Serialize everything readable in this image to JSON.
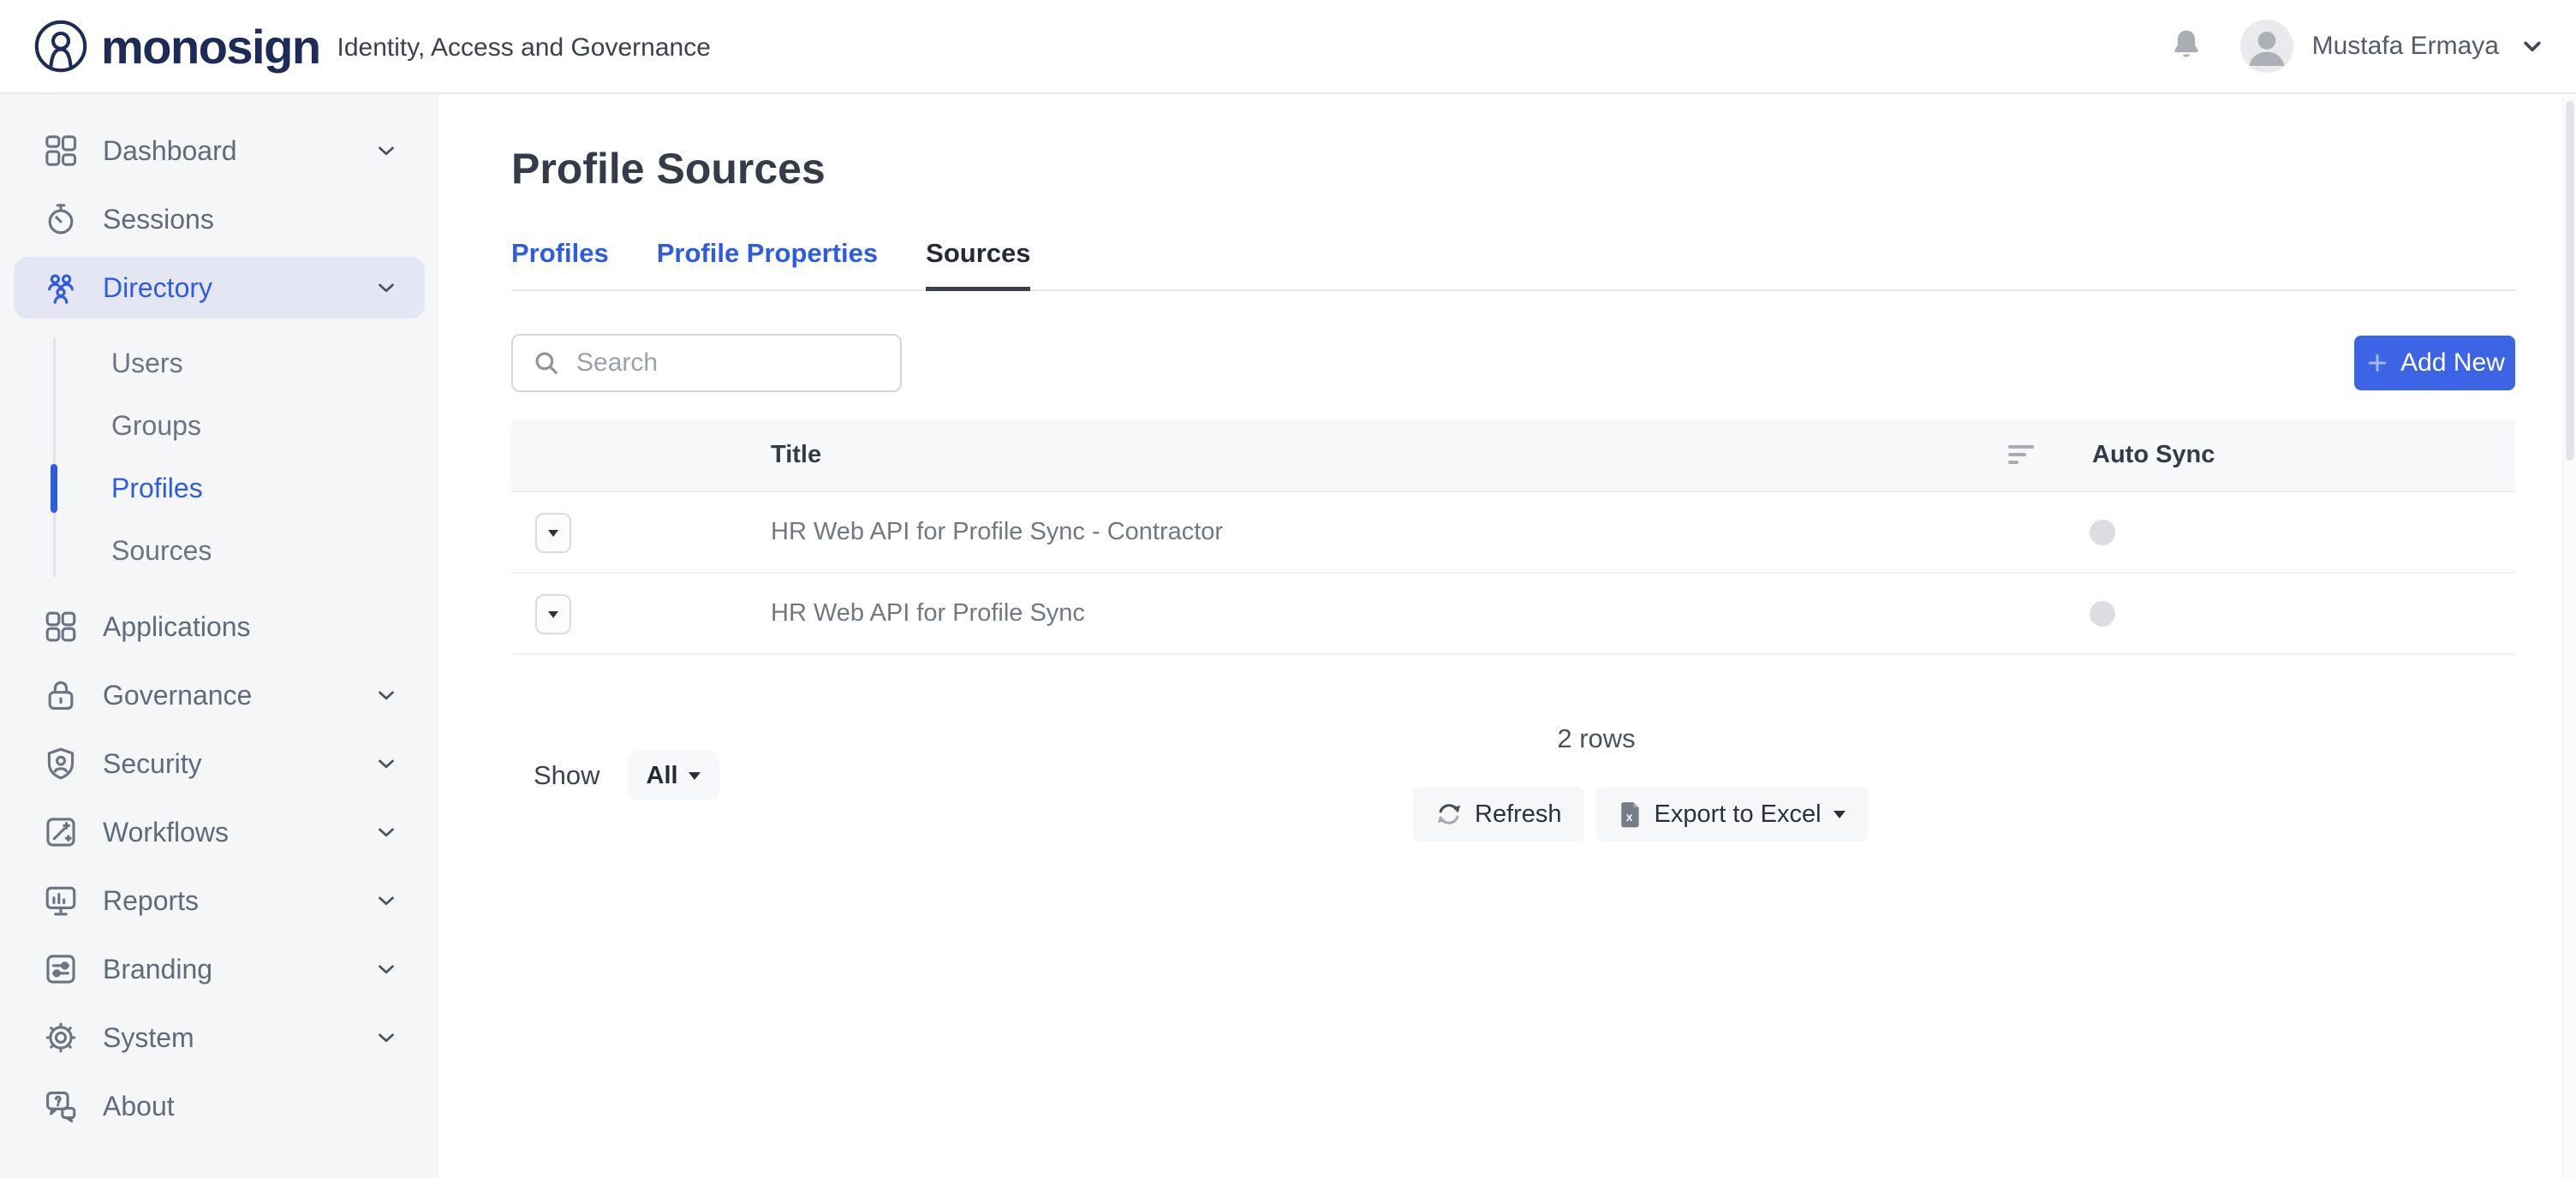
{
  "topbar": {
    "brand": "monosign",
    "tagline": "Identity, Access and Governance",
    "user_name": "Mustafa Ermaya",
    "icons": [
      "monosign-logo-icon",
      "bell-icon",
      "avatar",
      "chevron-down-icon"
    ]
  },
  "sidebar": {
    "items": [
      {
        "label": "Dashboard",
        "icon": "dashboard-icon",
        "chevron": true,
        "active": false
      },
      {
        "label": "Sessions",
        "icon": "stopwatch-icon",
        "chevron": false,
        "active": false
      },
      {
        "label": "Directory",
        "icon": "people-icon",
        "chevron": true,
        "active": true
      },
      {
        "label": "Applications",
        "icon": "apps-grid-icon",
        "chevron": false,
        "active": false
      },
      {
        "label": "Governance",
        "icon": "lock-icon",
        "chevron": true,
        "active": false
      },
      {
        "label": "Security",
        "icon": "shield-user-icon",
        "chevron": true,
        "active": false
      },
      {
        "label": "Workflows",
        "icon": "magic-wand-icon",
        "chevron": true,
        "active": false
      },
      {
        "label": "Reports",
        "icon": "monitor-chart-icon",
        "chevron": true,
        "active": false
      },
      {
        "label": "Branding",
        "icon": "sliders-icon",
        "chevron": true,
        "active": false
      },
      {
        "label": "System",
        "icon": "gear-icon",
        "chevron": true,
        "active": false
      },
      {
        "label": "About",
        "icon": "chat-question-icon",
        "chevron": false,
        "active": false
      }
    ],
    "directory_submenu": {
      "items": [
        {
          "label": "Users",
          "active": false
        },
        {
          "label": "Groups",
          "active": false
        },
        {
          "label": "Profiles",
          "active": true
        },
        {
          "label": "Sources",
          "active": false
        }
      ]
    }
  },
  "page": {
    "title": "Profile Sources",
    "tabs": [
      {
        "label": "Profiles",
        "active": false
      },
      {
        "label": "Profile Properties",
        "active": false
      },
      {
        "label": "Sources",
        "active": true
      }
    ],
    "search": {
      "placeholder": "Search",
      "value": ""
    },
    "add_new_label": "Add New"
  },
  "table": {
    "columns": [
      "Title",
      "Auto Sync"
    ],
    "rows": [
      {
        "title": "HR Web API for Profile Sync - Contractor",
        "auto_sync": "off"
      },
      {
        "title": "HR Web API for Profile Sync",
        "auto_sync": "off"
      }
    ],
    "row_count_label": "2 rows"
  },
  "footer": {
    "show_label": "Show",
    "show_value": "All",
    "refresh_label": "Refresh",
    "export_label": "Export to Excel"
  },
  "colors": {
    "brand_navy": "#1C2B57",
    "accent_blue": "#2E5BE6",
    "button_blue": "#3D64E4",
    "sidebar_bg": "#F5F6F8",
    "active_pill_bg": "#E4E7F3",
    "table_header_bg": "#F7F8FA",
    "sync_dot_gray": "#DCDDE0"
  }
}
